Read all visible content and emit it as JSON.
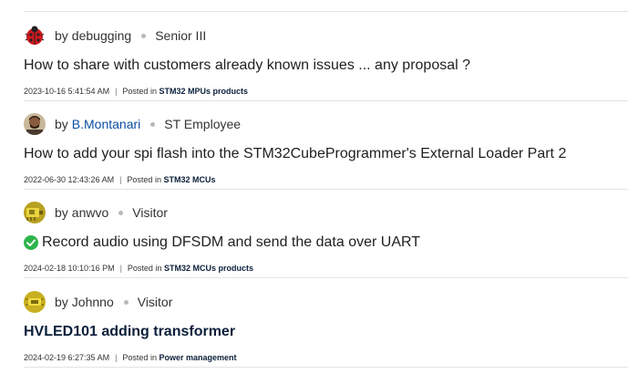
{
  "colors": {
    "accent": "#0b4ea2",
    "solved": "#2db34a",
    "divider": "#e3e3e3"
  },
  "posts": [
    {
      "avatar_icon": "ladybug-icon",
      "by": "by",
      "author": "debugging",
      "rank": "Senior III",
      "solved": false,
      "title": "How to share with customers already known issues ... any proposal ?",
      "timestamp": "2023-10-16 5:41:54 AM",
      "sep": "|",
      "posted_in": "Posted in",
      "board": "STM32 MPUs products"
    },
    {
      "avatar_icon": "person-photo-icon",
      "by": "by",
      "author": "B.Montanari",
      "rank": "ST Employee",
      "solved": false,
      "title": "How to add your spi flash into the STM32CubeProgrammer's External Loader Part 2",
      "timestamp": "2022-06-30 12:43:26 AM",
      "sep": "|",
      "posted_in": "Posted in",
      "board": "STM32 MCUs"
    },
    {
      "avatar_icon": "yellow-board-icon",
      "by": "by",
      "author": "anwvo",
      "rank": "Visitor",
      "solved": true,
      "title": "Record audio using DFSDM and send the data over UART",
      "timestamp": "2024-02-18 10:10:16 PM",
      "sep": "|",
      "posted_in": "Posted in",
      "board": "STM32 MCUs products"
    },
    {
      "avatar_icon": "yellow-chip-icon",
      "by": "by",
      "author": "Johnno",
      "rank": "Visitor",
      "solved": false,
      "title": "HVLED101 adding transformer",
      "timestamp": "2024-02-19 6:27:35 AM",
      "sep": "|",
      "posted_in": "Posted in",
      "board": "Power management"
    }
  ]
}
